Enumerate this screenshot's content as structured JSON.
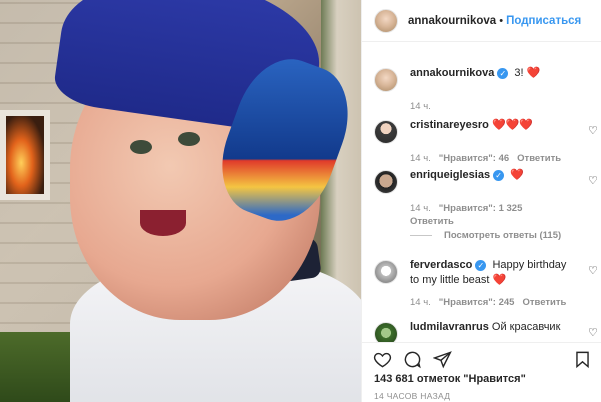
{
  "post": {
    "username": "annakournikova",
    "follow_label": "Подписаться",
    "dot": "•"
  },
  "caption": {
    "username": "annakournikova",
    "text": "3! ❤️",
    "time": "14 ч."
  },
  "comments": [
    {
      "username": "cristinareyesro",
      "text": "❤️❤️❤️",
      "time": "14 ч.",
      "likes": "\"Нравится\": 46",
      "reply": "Ответить",
      "verified": false
    },
    {
      "username": "enriqueiglesias",
      "text": "❤️",
      "time": "14 ч.",
      "likes": "\"Нравится\": 1 325",
      "reply": "Ответить",
      "verified": true
    },
    {
      "username": "ferverdasco",
      "text": "Happy birthday to my little beast ❤️",
      "time": "14 ч.",
      "likes": "\"Нравится\": 245",
      "reply": "Ответить",
      "verified": true
    },
    {
      "username": "ludmilavranrus",
      "text": "Ой красавчик",
      "verified": false
    }
  ],
  "view_replies": "Посмотреть ответы (115)",
  "footer": {
    "likes_text": "143 681 отметок \"Нравится\"",
    "timestamp": "14 ЧАСОВ НАЗАД"
  },
  "icons": {
    "like": "heart-icon",
    "comment": "comment-icon",
    "share": "share-icon",
    "save": "bookmark-icon"
  },
  "colors": {
    "accent": "#3897f0",
    "heart": "#ed4956",
    "muted": "#8e8e8e"
  }
}
